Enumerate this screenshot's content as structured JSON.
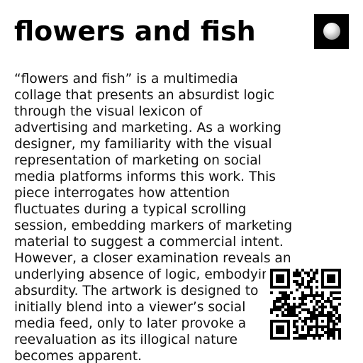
{
  "page": {
    "title": "flowers and fish"
  },
  "description": {
    "lines": [
      "“flowers and fish” is a multimedia",
      "collage that presents an absurdist logic",
      "through the visual lexicon of",
      "advertising and marketing. As a working",
      "designer, my familiarity with the visual",
      "representation of marketing on social",
      "media platforms informs this work. This",
      "piece interrogates how attention",
      "fluctuates during a typical scrolling",
      "session, embedding markers of marketing",
      "material to suggest a commercial intent.",
      "However, a closer examination reveals an",
      "underlying absence of logic, embodying",
      "absurdity. The artwork is designed to",
      "initially blend into a viewer’s social",
      "media feed, only to later provoke a",
      "reevaluation as its illogical nature",
      "becomes apparent."
    ]
  },
  "icons": {
    "thumbnail": "artwork-thumbnail-orb-icon",
    "qr": "qr-code-icon"
  },
  "colors": {
    "text": "#000000",
    "background": "#ffffff",
    "thumbnail_background": "#000000"
  }
}
